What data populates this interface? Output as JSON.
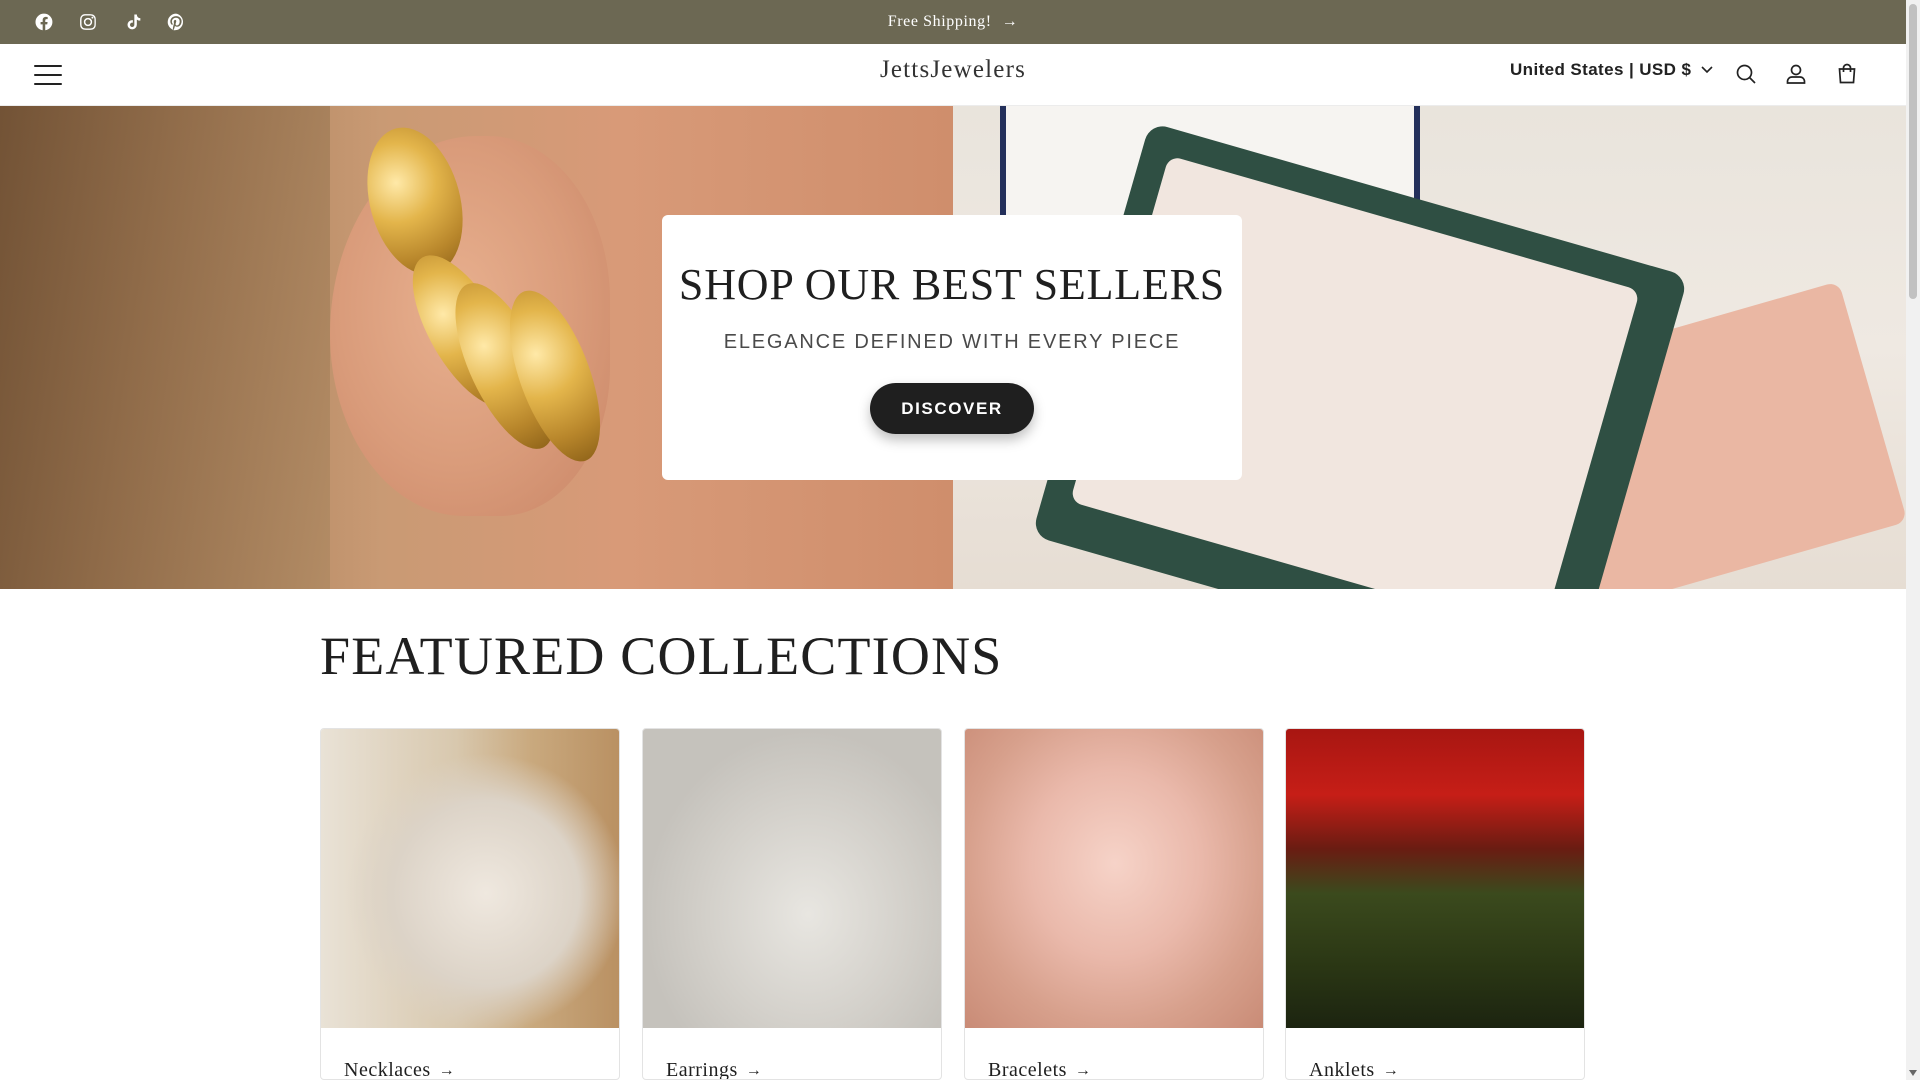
{
  "announcement": {
    "text": "Free Shipping!",
    "arrow": "→",
    "social_icons": [
      "facebook-icon",
      "instagram-icon",
      "tiktok-icon",
      "pinterest-icon"
    ]
  },
  "header": {
    "logo": "JettsJewelers",
    "country": "United States | USD $",
    "icons": [
      "menu-icon",
      "search-icon",
      "account-icon",
      "cart-icon"
    ]
  },
  "hero": {
    "title": "SHOP OUR BEST SELLERS",
    "subtitle": "ELEGANCE DEFINED WITH EVERY PIECE",
    "button": "DISCOVER"
  },
  "featured": {
    "title": "FEATURED COLLECTIONS",
    "collections": [
      {
        "label": "Necklaces"
      },
      {
        "label": "Earrings"
      },
      {
        "label": "Bracelets"
      },
      {
        "label": "Anklets"
      }
    ],
    "arrow": "→"
  },
  "colors": {
    "announcement_bg": "#6c6853",
    "button_bg": "#1f1f1f"
  }
}
